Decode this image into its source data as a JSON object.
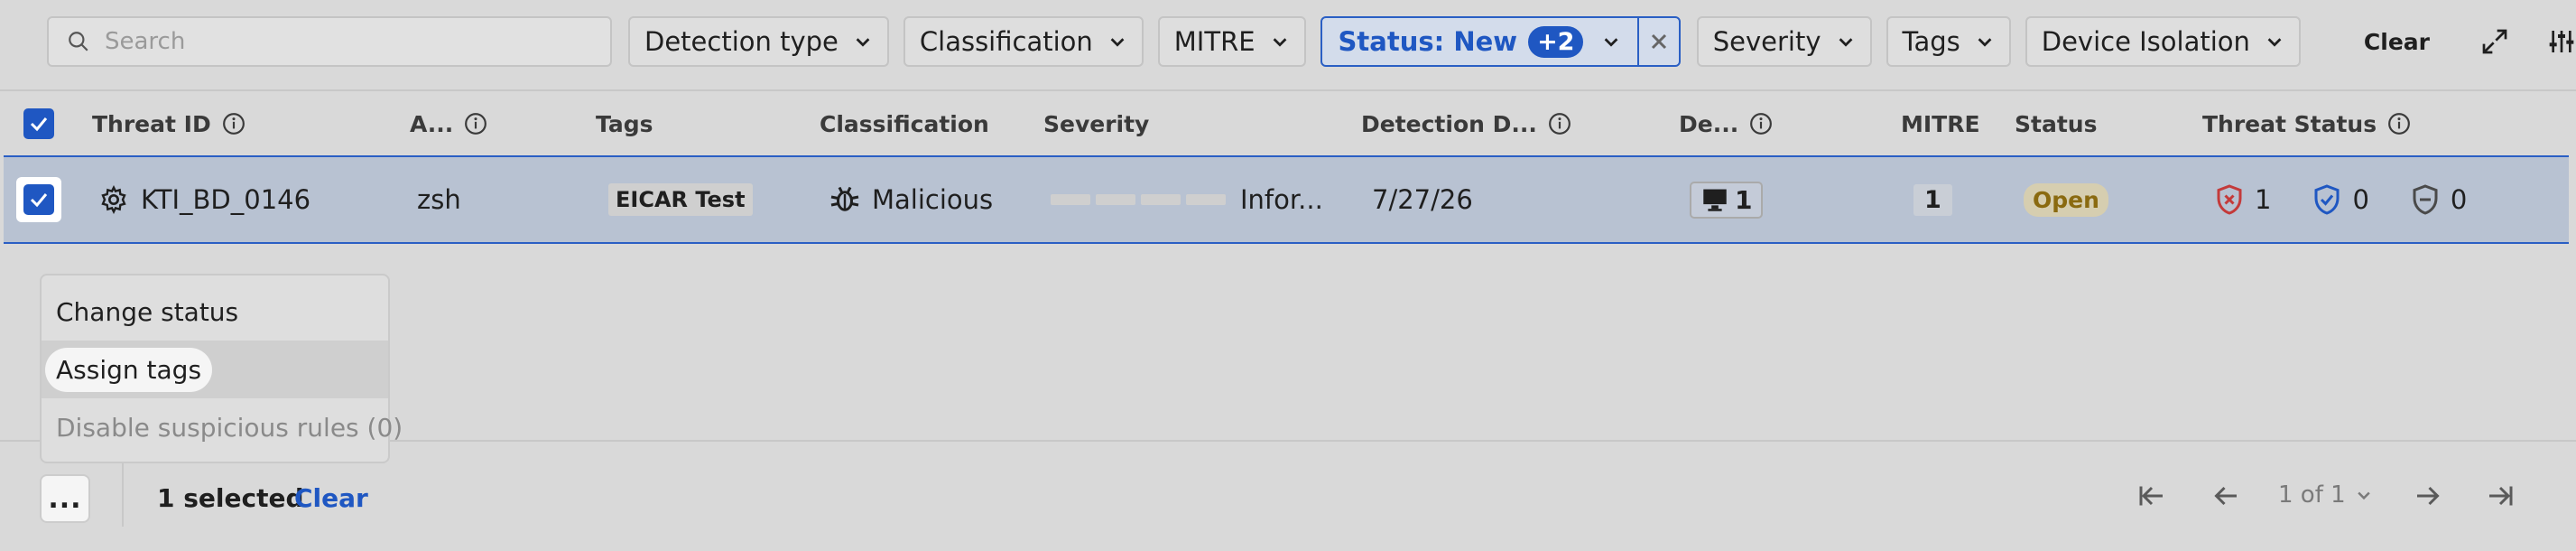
{
  "toolbar": {
    "search_placeholder": "Search",
    "filters": {
      "detection_type": "Detection type",
      "classification": "Classification",
      "mitre": "MITRE",
      "status_label": "Status: New",
      "status_badge": "+2",
      "severity": "Severity",
      "tags": "Tags",
      "device_isolation": "Device Isolation"
    },
    "clear_label": "Clear",
    "icons": [
      "expand-icon",
      "settings-sliders-icon"
    ]
  },
  "table": {
    "columns": {
      "threat_id": "Threat ID",
      "a": "A...",
      "tags": "Tags",
      "classification": "Classification",
      "severity": "Severity",
      "detection_date": "Detection D...",
      "device": "De...",
      "mitre": "MITRE",
      "status": "Status",
      "threat_status": "Threat Status"
    },
    "rows": [
      {
        "threat_id": "KTI_BD_0146",
        "a": "zsh",
        "tag": "EICAR Test",
        "classification": "Malicious",
        "severity": "Infor...",
        "detection_date": "7/27/26",
        "device_count": "1",
        "mitre_count": "1",
        "status": "Open",
        "threat_status": {
          "red": "1",
          "blue": "0",
          "grey": "0"
        }
      }
    ]
  },
  "context_menu": {
    "items": [
      {
        "label": "Change status",
        "state": "normal"
      },
      {
        "label": "Assign tags",
        "state": "hover"
      },
      {
        "label": "Disable suspicious rules (0)",
        "state": "disabled"
      }
    ]
  },
  "footer": {
    "more_label": "...",
    "selected_text": "1 selected",
    "clear_label": "Clear",
    "page_text": "1 of 1"
  },
  "colors": {
    "accent": "#1f57c2",
    "row_selected_bg": "#b8c2d2",
    "status_open_text": "#8a6a10",
    "threat_red": "#c43a3a",
    "threat_blue": "#1f57c2"
  }
}
